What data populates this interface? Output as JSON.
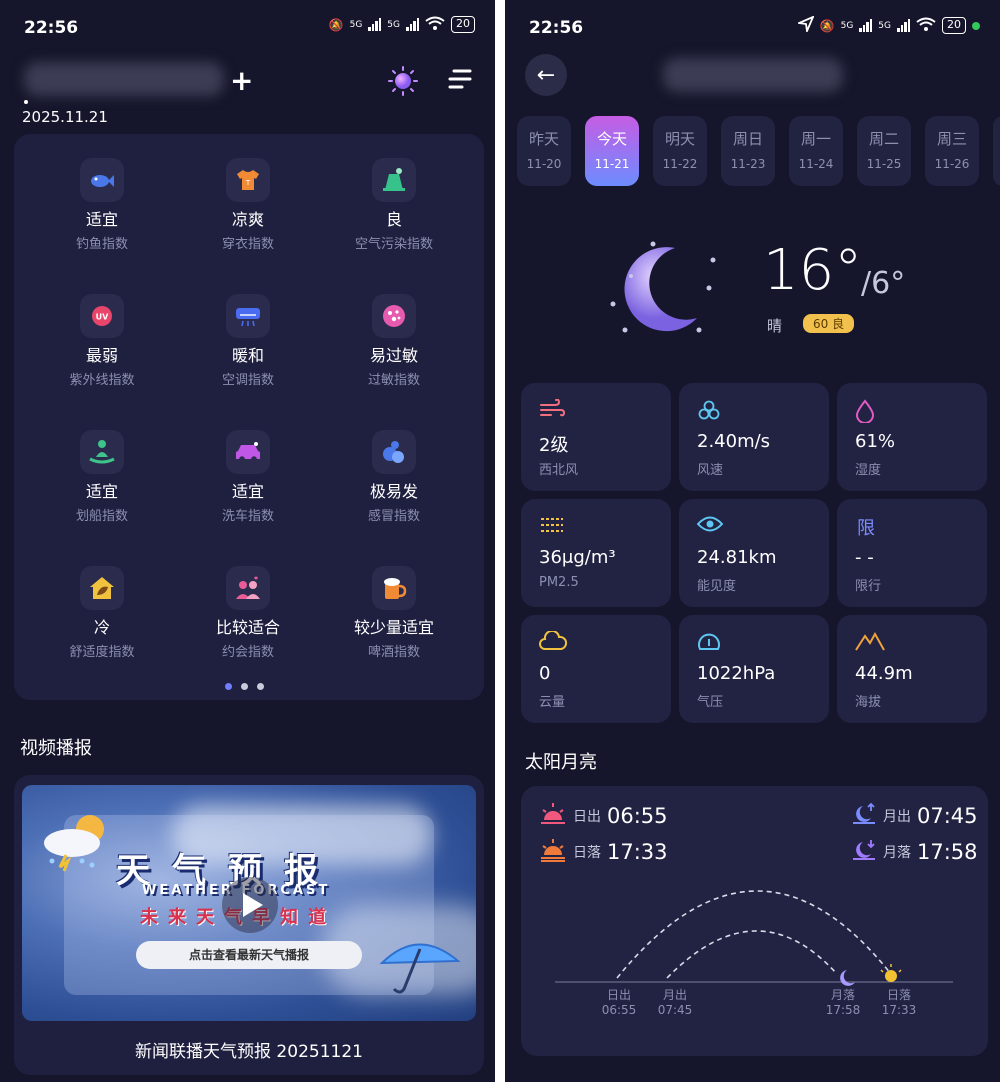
{
  "status": {
    "time": "22:56",
    "battery": "20",
    "net1": "5G",
    "net2": "5G"
  },
  "left": {
    "date": "2025.11.21",
    "indices": [
      {
        "value": "适宜",
        "name": "钓鱼指数",
        "icon": "fish-icon",
        "color": "#4a78e8"
      },
      {
        "value": "凉爽",
        "name": "穿衣指数",
        "icon": "shirt-icon",
        "color": "#f08a35"
      },
      {
        "value": "良",
        "name": "空气污染指数",
        "icon": "factory-icon",
        "color": "#36c28a"
      },
      {
        "value": "最弱",
        "name": "紫外线指数",
        "icon": "uv-icon",
        "color": "#e8456a"
      },
      {
        "value": "暖和",
        "name": "空调指数",
        "icon": "air-conditioner-icon",
        "color": "#4a6cf0"
      },
      {
        "value": "易过敏",
        "name": "过敏指数",
        "icon": "allergy-icon",
        "color": "#e65bb0"
      },
      {
        "value": "适宜",
        "name": "划船指数",
        "icon": "rowing-icon",
        "color": "#3ec48b"
      },
      {
        "value": "适宜",
        "name": "洗车指数",
        "icon": "car-icon",
        "color": "#c157e6"
      },
      {
        "value": "极易发",
        "name": "感冒指数",
        "icon": "pills-icon",
        "color": "#4a78e8"
      },
      {
        "value": "冷",
        "name": "舒适度指数",
        "icon": "house-leaf-icon",
        "color": "#f0c23d"
      },
      {
        "value": "比较适合",
        "name": "约会指数",
        "icon": "couple-icon",
        "color": "#ea5c95"
      },
      {
        "value": "较少量适宜",
        "name": "啤酒指数",
        "icon": "beer-icon",
        "color": "#f08a35"
      }
    ],
    "video_section_title": "视频播报",
    "video": {
      "title_cn": "天气预报",
      "title_en": "WEATHER FORCAST",
      "subtitle": "未来天气早知道",
      "pill": "点击查看最新天气播报",
      "caption": "新闻联播天气预报 20251121"
    }
  },
  "right": {
    "days": [
      {
        "name": "昨天",
        "date": "11-20",
        "active": false
      },
      {
        "name": "今天",
        "date": "11-21",
        "active": true
      },
      {
        "name": "明天",
        "date": "11-22",
        "active": false
      },
      {
        "name": "周日",
        "date": "11-23",
        "active": false
      },
      {
        "name": "周一",
        "date": "11-24",
        "active": false
      },
      {
        "name": "周二",
        "date": "11-25",
        "active": false
      },
      {
        "name": "周三",
        "date": "11-26",
        "active": false
      }
    ],
    "temp": "16°",
    "temp_low": "/6°",
    "condition": "晴",
    "aqi": "60 良",
    "stats": [
      {
        "value": "2级",
        "label": "西北风",
        "icon": "wind-icon",
        "color": "#f26f7f"
      },
      {
        "value": "2.40m/s",
        "label": "风速",
        "icon": "fan-icon",
        "color": "#5ec6f0"
      },
      {
        "value": "61%",
        "label": "湿度",
        "icon": "droplet-icon",
        "color": "#e05bc3"
      },
      {
        "value": "36μg/m³",
        "label": "PM2.5",
        "icon": "haze-icon",
        "color": "#f0c23d"
      },
      {
        "value": "24.81km",
        "label": "能见度",
        "icon": "eye-icon",
        "color": "#5ec6f0"
      },
      {
        "value": "- -",
        "label": "限行",
        "icon": "restriction-icon",
        "color": "#7b8cff",
        "glyph": "限"
      },
      {
        "value": "0",
        "label": "云量",
        "icon": "cloud-icon",
        "color": "#f0c23d"
      },
      {
        "value": "1022hPa",
        "label": "气压",
        "icon": "gauge-icon",
        "color": "#5ec6f0"
      },
      {
        "value": "44.9m",
        "label": "海拔",
        "icon": "mountain-icon",
        "color": "#f0a23d"
      }
    ],
    "sun_section_title": "太阳月亮",
    "sunrise_label": "日出",
    "sunrise": "06:55",
    "sunset_label": "日落",
    "sunset": "17:33",
    "moonrise_label": "月出",
    "moonrise": "07:45",
    "moonset_label": "月落",
    "moonset": "17:58",
    "axis": [
      {
        "label": "日出",
        "time": "06:55"
      },
      {
        "label": "月出",
        "time": "07:45"
      },
      {
        "label": "月落",
        "time": "17:58"
      },
      {
        "label": "日落",
        "time": "17:33"
      }
    ]
  }
}
